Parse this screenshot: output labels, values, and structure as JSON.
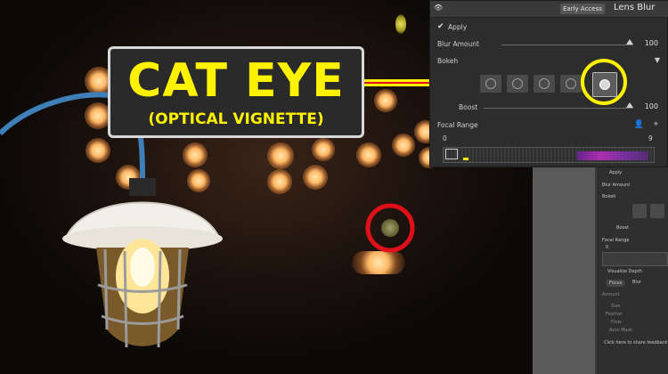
{
  "callout": {
    "title": "CAT EYE",
    "subtitle": "(OPTICAL VIGNETTE)"
  },
  "panel": {
    "badge": "Early Access",
    "title": "Lens Blur",
    "apply_label": "Apply",
    "blur_amount_label": "Blur Amount",
    "blur_amount_value": "100",
    "bokeh_label": "Bokeh",
    "boost_label": "Boost",
    "boost_value": "100",
    "focal_range_label": "Focal Range",
    "focal_min": "0",
    "focal_max": "9"
  },
  "side_panel": {
    "apply_label": "Apply",
    "blur_amount_label": "Blur Amount",
    "bokeh_label": "Bokeh",
    "boost_label": "Boost",
    "focal_range_label": "Focal Range",
    "focal_min": "0",
    "visualize_depth_label": "Visualize Depth",
    "focus_tab": "Focus",
    "blur_tab": "Blur",
    "amount_label": "Amount",
    "size_label": "Size",
    "feather_label": "Feather",
    "flow_label": "Flow",
    "automask_label": "Auto Mask",
    "feedback_label": "Click here to share feedback"
  },
  "colors": {
    "highlight_yellow": "#fff200",
    "marker_red": "#e0101a",
    "panel_bg": "#2d2d2d"
  },
  "icons": {
    "visibility": "eye-icon",
    "checkbox": "checkbox-checked-icon",
    "collapse": "triangle-down-icon",
    "person": "person-icon",
    "target": "crosshair-icon",
    "cursor": "arrow-cursor-icon"
  }
}
